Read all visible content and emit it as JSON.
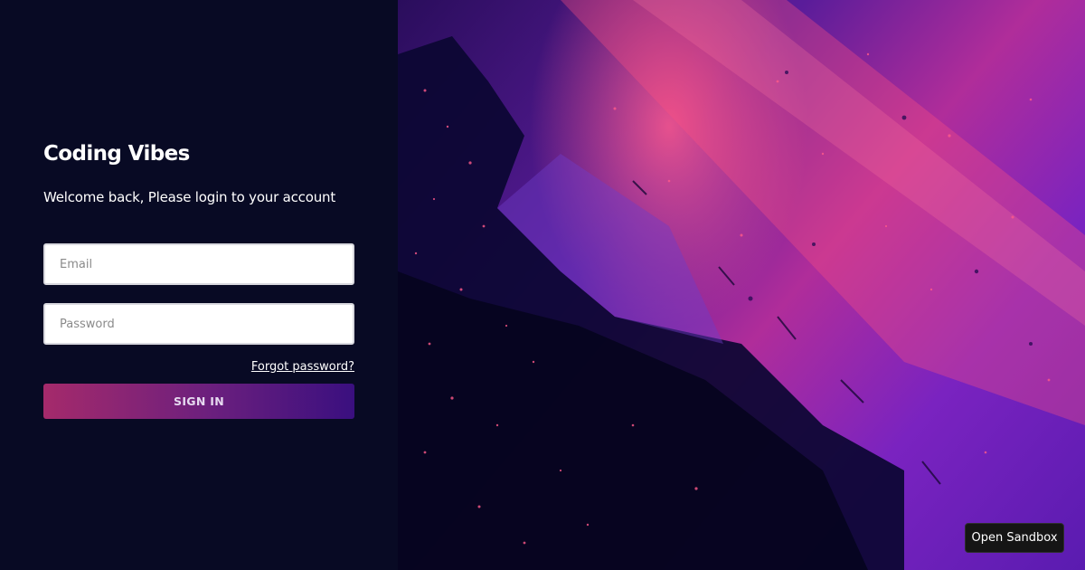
{
  "app": {
    "title": "Coding Vibes"
  },
  "login": {
    "subtitle": "Welcome back, Please login to your account",
    "email_placeholder": "Email",
    "password_placeholder": "Password",
    "forgot_label": "Forgot password?",
    "sign_in_label": "SIGN IN"
  },
  "colors": {
    "panel_background": "#080a24",
    "button_gradient_start": "#a52a6b",
    "button_gradient_end": "#3a0f7f"
  },
  "sandbox": {
    "label": "Open Sandbox"
  }
}
